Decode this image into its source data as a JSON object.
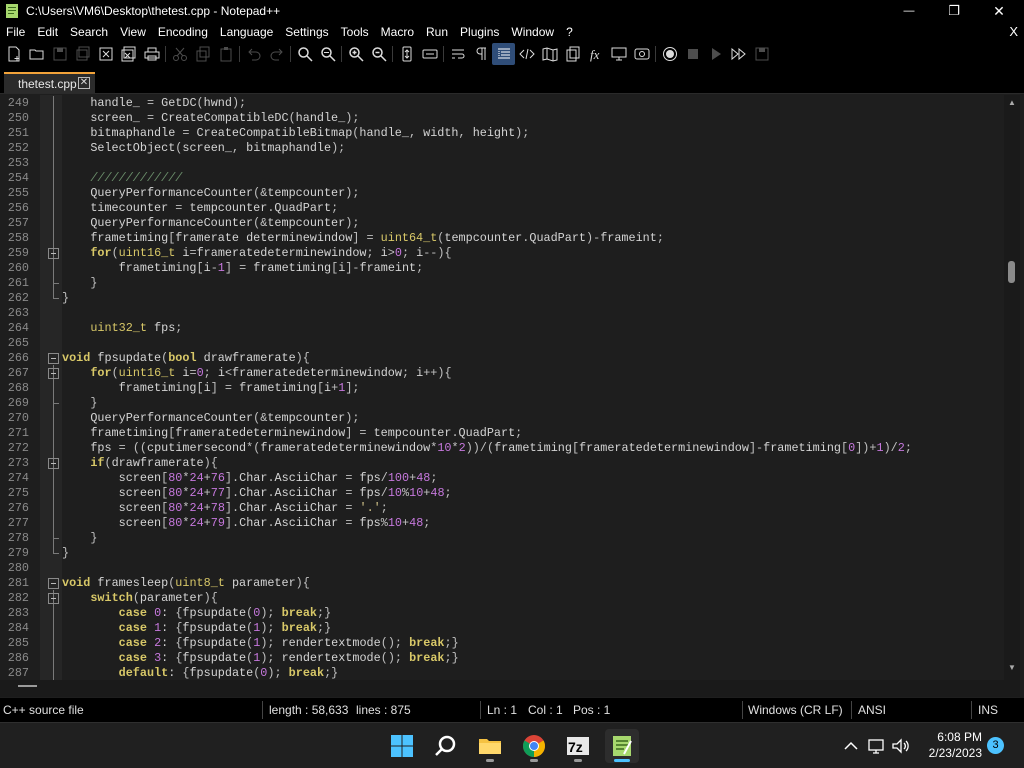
{
  "window": {
    "title": "C:\\Users\\VM6\\Desktop\\thetest.cpp - Notepad++",
    "minimize_glyph": "—",
    "maximize_glyph": "❐",
    "close_glyph": "✕"
  },
  "menu": {
    "items": [
      "File",
      "Edit",
      "Search",
      "View",
      "Encoding",
      "Language",
      "Settings",
      "Tools",
      "Macro",
      "Run",
      "Plugins",
      "Window",
      "?"
    ],
    "close_doc": "X"
  },
  "tab": {
    "label": "thetest.cpp",
    "close_glyph": "✕"
  },
  "editor": {
    "lines": [
      {
        "n": "249",
        "code": "    handle_ = GetDC(hwnd);"
      },
      {
        "n": "250",
        "code": "    screen_ = CreateCompatibleDC(handle_);"
      },
      {
        "n": "251",
        "code": "    bitmaphandle = CreateCompatibleBitmap(handle_, width, height);"
      },
      {
        "n": "252",
        "code": "    SelectObject(screen_, bitmaphandle);"
      },
      {
        "n": "253",
        "code": ""
      },
      {
        "n": "254",
        "code": "    /////////////"
      },
      {
        "n": "255",
        "code": "    QueryPerformanceCounter(&tempcounter);"
      },
      {
        "n": "256",
        "code": "    timecounter = tempcounter.QuadPart;"
      },
      {
        "n": "257",
        "code": "    QueryPerformanceCounter(&tempcounter);"
      },
      {
        "n": "258",
        "code": "    frametiming[framerate determinewindow] = uint64_t(tempcounter.QuadPart)-frameint;"
      },
      {
        "n": "259",
        "code": "    for(uint16_t i=frameratedeterminewindow; i>0; i--){"
      },
      {
        "n": "260",
        "code": "        frametiming[i-1] = frametiming[i]-frameint;"
      },
      {
        "n": "261",
        "code": "    }"
      },
      {
        "n": "262",
        "code": "}"
      },
      {
        "n": "263",
        "code": ""
      },
      {
        "n": "264",
        "code": "    uint32_t fps;"
      },
      {
        "n": "265",
        "code": ""
      },
      {
        "n": "266",
        "code": "void fpsupdate(bool drawframerate){"
      },
      {
        "n": "267",
        "code": "    for(uint16_t i=0; i<frameratedeterminewindow; i++){"
      },
      {
        "n": "268",
        "code": "        frametiming[i] = frametiming[i+1];"
      },
      {
        "n": "269",
        "code": "    }"
      },
      {
        "n": "270",
        "code": "    QueryPerformanceCounter(&tempcounter);"
      },
      {
        "n": "271",
        "code": "    frametiming[frameratedeterminewindow] = tempcounter.QuadPart;"
      },
      {
        "n": "272",
        "code": "    fps = ((cputimersecond*(frameratedeterminewindow*10*2))/(frametiming[frameratedeterminewindow]-frametiming[0])+1)/2;"
      },
      {
        "n": "273",
        "code": "    if(drawframerate){"
      },
      {
        "n": "274",
        "code": "        screen[80*24+76].Char.AsciiChar = fps/100+48;"
      },
      {
        "n": "275",
        "code": "        screen[80*24+77].Char.AsciiChar = fps/10%10+48;"
      },
      {
        "n": "276",
        "code": "        screen[80*24+78].Char.AsciiChar = '.';"
      },
      {
        "n": "277",
        "code": "        screen[80*24+79].Char.AsciiChar = fps%10+48;"
      },
      {
        "n": "278",
        "code": "    }"
      },
      {
        "n": "279",
        "code": "}"
      },
      {
        "n": "280",
        "code": ""
      },
      {
        "n": "281",
        "code": "void framesleep(uint8_t parameter){"
      },
      {
        "n": "282",
        "code": "    switch(parameter){"
      },
      {
        "n": "283",
        "code": "        case 0: {fpsupdate(0); break;}"
      },
      {
        "n": "284",
        "code": "        case 1: {fpsupdate(1); break;}"
      },
      {
        "n": "285",
        "code": "        case 2: {fpsupdate(1); rendertextmode(); break;}"
      },
      {
        "n": "286",
        "code": "        case 3: {fpsupdate(1); rendertextmode(); break;}"
      },
      {
        "n": "287",
        "code": "        default: {fpsupdate(0); break;}"
      }
    ]
  },
  "status": {
    "file_type": "C++ source file",
    "length": "length : 58,633",
    "lines": "lines : 875",
    "ln": "Ln : 1",
    "col": "Col : 1",
    "pos": "Pos : 1",
    "eol": "Windows (CR LF)",
    "encoding": "ANSI",
    "mode": "INS"
  },
  "taskbar": {
    "time": "6:08 PM",
    "date": "2/23/2023",
    "notifications": "3",
    "sevenzip_label": "7z"
  },
  "colors": {
    "accent": "#4cc2ff",
    "tab_accent": "#f2a33a",
    "keyword": "#d8c868"
  }
}
